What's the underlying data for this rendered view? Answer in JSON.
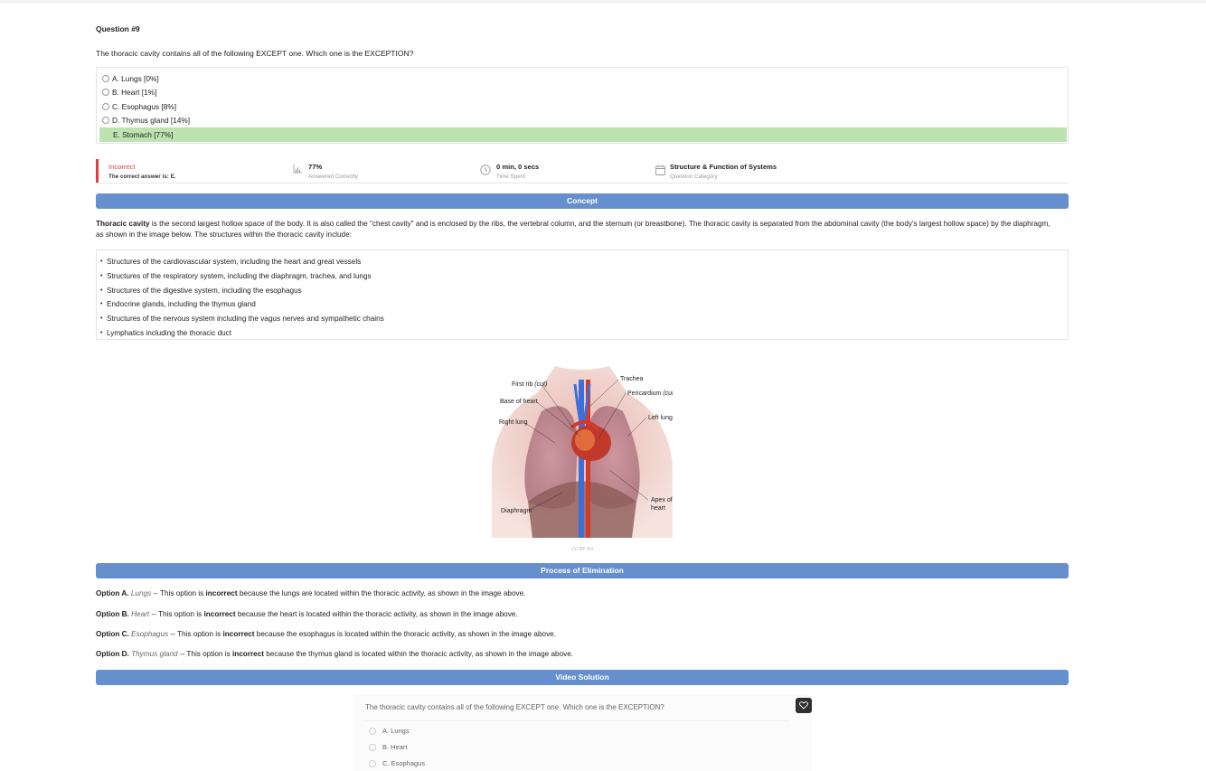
{
  "question": {
    "title": "Question #9",
    "text": "The thoracic cavity contains all of the following EXCEPT one. Which one is the EXCEPTION?",
    "options": [
      {
        "label": "A. Lungs [0%]"
      },
      {
        "label": "B. Heart [1%]"
      },
      {
        "label": "C. Esophagus [8%]"
      },
      {
        "label": "D. Thymus gland [14%]"
      },
      {
        "label": "E. Stomach [77%]",
        "correct": true
      }
    ]
  },
  "stats": {
    "result": {
      "value": "Incorrect",
      "label": "The correct answer is: E."
    },
    "percent": {
      "value": "77%",
      "label": "Answered Correctly",
      "icon": "bar-chart-icon"
    },
    "time": {
      "value": "0 min, 0 secs",
      "label": "Time Spent",
      "icon": "clock-icon"
    },
    "category": {
      "value": "Structure & Function of Systems",
      "label": "Question Category",
      "icon": "calendar-icon"
    }
  },
  "concept": {
    "header": "Concept",
    "intro_bold": "Thoracic cavity",
    "intro_rest": " is the second largest hollow space of the body. It is also called the \"chest cavity\" and is enclosed by the ribs, the vertebral column, and the sternum (or breastbone). The thoracic cavity is separated from the abdominal cavity (the body's largest hollow space) by the diaphragm, as shown in the image below. The structures within the thoracic cavity include:",
    "bullets": [
      "Structures of the cardiovascular system, including the heart and great vessels",
      "Structures of the respiratory system, including the diaphragm, trachea, and lungs",
      "Structures of the digestive system, including the esophagus",
      "Endocrine glands, including the thymus gland",
      "Structures of the nervous system including the vagus nerves and sympathetic chains",
      "Lymphatics including the thoracic duct"
    ],
    "figure_labels": {
      "first_rib": "First rib",
      "cut": "(cut)",
      "trachea": "Trachea",
      "pericardium": "Pericardium",
      "base_heart": "Base of heart",
      "left_lung": "Left lung",
      "right_lung": "Right lung",
      "apex_1": "Apex of",
      "apex_2": "heart",
      "diaphragm": "Diaphragm"
    },
    "credit": "CC BY 4.0"
  },
  "elimination": {
    "header": "Process of Elimination",
    "items": [
      {
        "prefix": "Option A.",
        "term": "Lungs",
        "mid": " -- This option is ",
        "bold": "incorrect",
        "rest": " because the lungs are located within the thoracic activity, as shown in the image above."
      },
      {
        "prefix": "Option B.",
        "term": "Heart",
        "mid": " -- This option is ",
        "bold": "incorrect",
        "rest": " because the heart is located within the thoracic activity, as shown in the image above."
      },
      {
        "prefix": "Option C.",
        "term": "Esophagus",
        "mid": " -- This option is ",
        "bold": "incorrect",
        "rest": " because the esophagus is located within the thoracic activity, as shown in the image above."
      },
      {
        "prefix": "Option D.",
        "term": "Thymus gland",
        "mid": " -- This option is ",
        "bold": "incorrect",
        "rest": " because the thymus gland is located within the thoracic activity, as shown in the image above."
      }
    ]
  },
  "video": {
    "header": "Video Solution",
    "question": "The thoracic cavity contains all of the following EXCEPT one. Which one is the EXCEPTION?",
    "options": [
      "A. Lungs",
      "B. Heart",
      "C. Esophagus"
    ]
  },
  "colors": {
    "accent_bar": "#6690cd",
    "correct_bg": "#bde3b1",
    "incorrect": "#e23c3c"
  }
}
